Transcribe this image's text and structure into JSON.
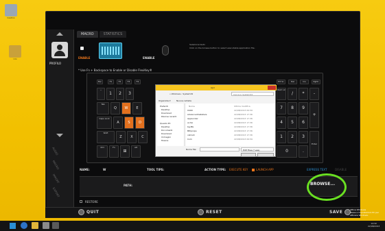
{
  "desktop": {
    "icons": [
      {
        "label": "Cestino",
        "color": "#9aa7b3"
      },
      {
        "label": "Uni",
        "color": "#c9a13a"
      }
    ]
  },
  "app": {
    "tabs": [
      "MACRO",
      "STATISTICS"
    ],
    "sidebar": {
      "profile_label": "PROFILO",
      "vertical_items": [
        "AUDIO",
        "MACRO",
        "IMPORT",
        "EXPORT"
      ]
    },
    "enable_left": "ENABLE",
    "enable_right": "ENABLE",
    "hint_title": "Seleziona tasto",
    "hint_body": "Click on the browse button to select executable application file.",
    "fn_note": "* Use Fn + Backspace to Enable or Disable FlexiKey®",
    "name_label": "NAME:",
    "name_value": "W",
    "tooltips_label": "TOOL TIPS:",
    "action_label": "ACTION TYPE:",
    "action_options": [
      "EXECUTE KEY",
      "LAUNCH APP",
      "EXPRESS TEXT",
      "DISABLE"
    ],
    "path_label": "PATH:",
    "browse_label": "BROWSE...",
    "restore_label": "RESTORE",
    "quit_label": "QUIT",
    "reset_label": "RESET",
    "save_label": "SAVE",
    "accent_color": "#e8741b"
  },
  "dialog": {
    "title": "Apri",
    "breadcrumb": "« Windows › System32",
    "search_placeholder": "Cerca in System32",
    "organize": "Organizza ▾",
    "new_folder": "Nuova cartella",
    "nav": [
      "Preferiti",
      "Desktop",
      "Download",
      "Risorse recenti",
      "Questo PC",
      "Desktop",
      "Documenti",
      "Download",
      "Immagini",
      "Musica"
    ],
    "col_name": "Nome",
    "col_date": "Ultima modifica",
    "files": [
      {
        "name": "0409",
        "date": "22/08/2013 09:59"
      },
      {
        "name": "AdvancedInstallers",
        "date": "22/08/2013 17:36"
      },
      {
        "name": "AppLocker",
        "date": "22/08/2013 17:36"
      },
      {
        "name": "ar-SA",
        "date": "22/08/2013 17:36"
      },
      {
        "name": "bg-BG",
        "date": "22/08/2013 17:36"
      },
      {
        "name": "Bthprops",
        "date": "22/08/2013 17:36"
      },
      {
        "name": "catroot",
        "date": "22/08/2013 17:36"
      },
      {
        "name": "Com",
        "date": "22/08/2013 09:59"
      }
    ],
    "filename_label": "Nome file:",
    "filter": "EXE Files (*.exe)",
    "open_button": "Apri",
    "cancel_button": "Annulla"
  },
  "keyboard": {
    "row0": [
      "Esc",
      "F1",
      "F2",
      "F3",
      "F4",
      "Prt Sc",
      "Del",
      "Ins",
      "Ins",
      "PgDn"
    ],
    "row1": [
      "~",
      "1",
      "2",
      "3",
      "Backspace",
      "Num Lk",
      "/",
      "*",
      "-"
    ],
    "row2": [
      "Tab",
      "Q",
      "W",
      "E",
      "7",
      "8",
      "9",
      "+"
    ],
    "row3": [
      "Caps Lock",
      "A",
      "S",
      "D",
      "4",
      "5",
      "6"
    ],
    "row4": [
      "Shift",
      "Z",
      "X",
      "C",
      "1",
      "2",
      "3",
      "Enter"
    ],
    "row5": [
      "Ctrl",
      "Fn",
      "Alt",
      "0",
      "."
    ]
  },
  "taskbar": {
    "time": "14:32",
    "date": "22/08/2013",
    "watermark": [
      "Attiva Windows",
      "Passa a Impostazioni PC per attivare Windows."
    ]
  }
}
